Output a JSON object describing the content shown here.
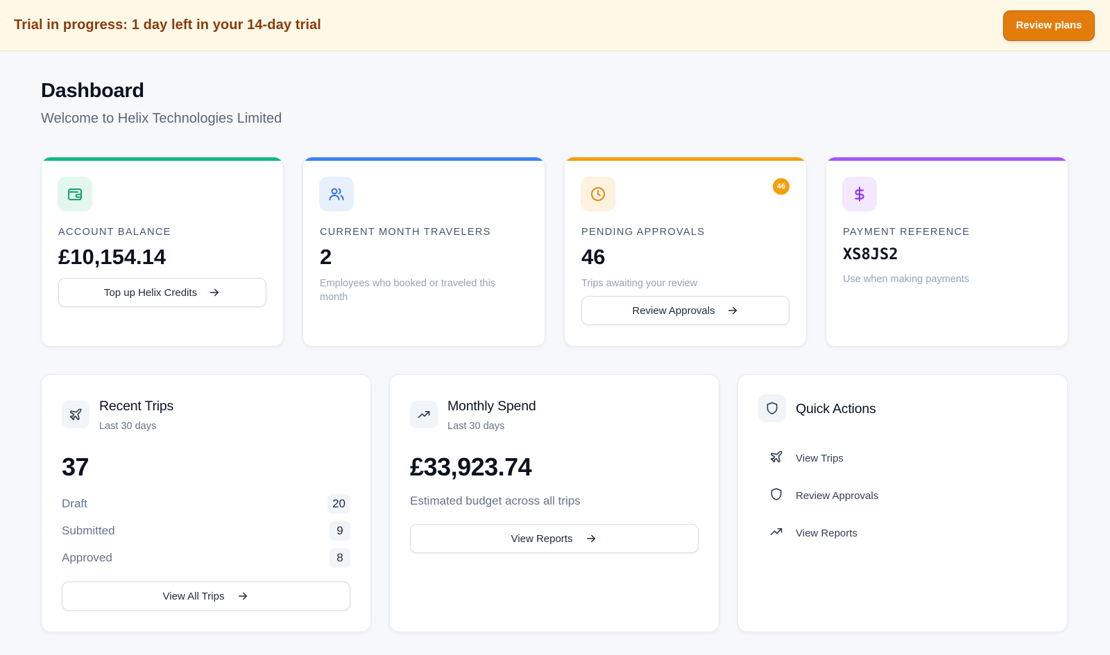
{
  "banner": {
    "text": "Trial in progress: 1 day left in your 14-day trial",
    "button": "Review plans"
  },
  "header": {
    "title": "Dashboard",
    "subtitle": "Welcome to Helix Technologies Limited"
  },
  "cards": {
    "balance": {
      "label": "ACCOUNT BALANCE",
      "value": "£10,154.14",
      "button": "Top up Helix Credits",
      "icon": "wallet-icon",
      "accent": "#10b981"
    },
    "travelers": {
      "label": "CURRENT MONTH TRAVELERS",
      "value": "2",
      "desc": "Employees who booked or traveled this month",
      "icon": "users-icon",
      "accent": "#3b82f6"
    },
    "approvals": {
      "label": "PENDING APPROVALS",
      "value": "46",
      "badge": "46",
      "desc": "Trips awaiting your review",
      "button": "Review Approvals",
      "icon": "clock-icon",
      "accent": "#f59e0b"
    },
    "payment": {
      "label": "PAYMENT REFERENCE",
      "value": "XS8JS2",
      "desc": "Use when making payments",
      "icon": "dollar-icon",
      "accent": "#a855f7"
    }
  },
  "recent_trips": {
    "title": "Recent Trips",
    "subtitle": "Last 30 days",
    "total": "37",
    "rows": [
      {
        "label": "Draft",
        "value": "20"
      },
      {
        "label": "Submitted",
        "value": "9"
      },
      {
        "label": "Approved",
        "value": "8"
      }
    ],
    "button": "View All Trips"
  },
  "monthly_spend": {
    "title": "Monthly Spend",
    "subtitle": "Last 30 days",
    "total": "£33,923.74",
    "desc": "Estimated budget across all trips",
    "button": "View Reports"
  },
  "quick_actions": {
    "title": "Quick Actions",
    "items": [
      {
        "label": "View Trips",
        "icon": "plane-icon"
      },
      {
        "label": "Review Approvals",
        "icon": "shield-icon"
      },
      {
        "label": "View Reports",
        "icon": "trending-up-icon"
      }
    ]
  }
}
